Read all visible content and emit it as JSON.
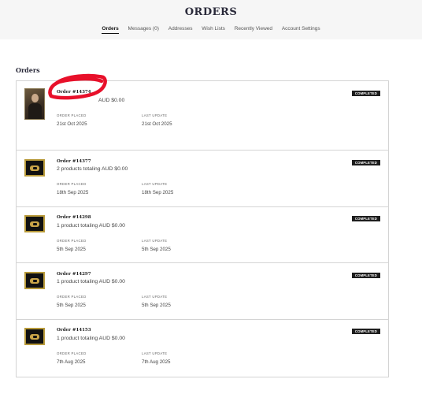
{
  "header": {
    "title": "ORDERS"
  },
  "nav": {
    "items": [
      "Orders",
      "Messages (0)",
      "Addresses",
      "Wish Lists",
      "Recently Viewed",
      "Account Settings"
    ],
    "active": "Orders"
  },
  "section_title": "Orders",
  "labels": {
    "order_placed": "ORDER PLACED",
    "last_update": "LAST UPDATE"
  },
  "orders": [
    {
      "number": "Order #14374",
      "summary": "AUD $0.00",
      "placed": "21st Oct 2025",
      "updated": "21st Oct 2025",
      "status": "COMPLETED",
      "thumb": "portrait-painting"
    },
    {
      "number": "Order #14377",
      "summary": "2 products totaling AUD $0.00",
      "placed": "18th Sep 2025",
      "updated": "18th Sep 2025",
      "status": "COMPLETED",
      "thumb": "eye-logo"
    },
    {
      "number": "Order #14298",
      "summary": "1 product totaling AUD $0.00",
      "placed": "5th Sep 2025",
      "updated": "5th Sep 2025",
      "status": "COMPLETED",
      "thumb": "eye-logo"
    },
    {
      "number": "Order #14297",
      "summary": "1 product totaling AUD $0.00",
      "placed": "5th Sep 2025",
      "updated": "5th Sep 2025",
      "status": "COMPLETED",
      "thumb": "eye-logo"
    },
    {
      "number": "Order #14153",
      "summary": "1 product totaling AUD $0.00",
      "placed": "7th Aug 2025",
      "updated": "7th Aug 2025",
      "status": "COMPLETED",
      "thumb": "eye-logo"
    }
  ],
  "annotation_color": "#e8102a"
}
